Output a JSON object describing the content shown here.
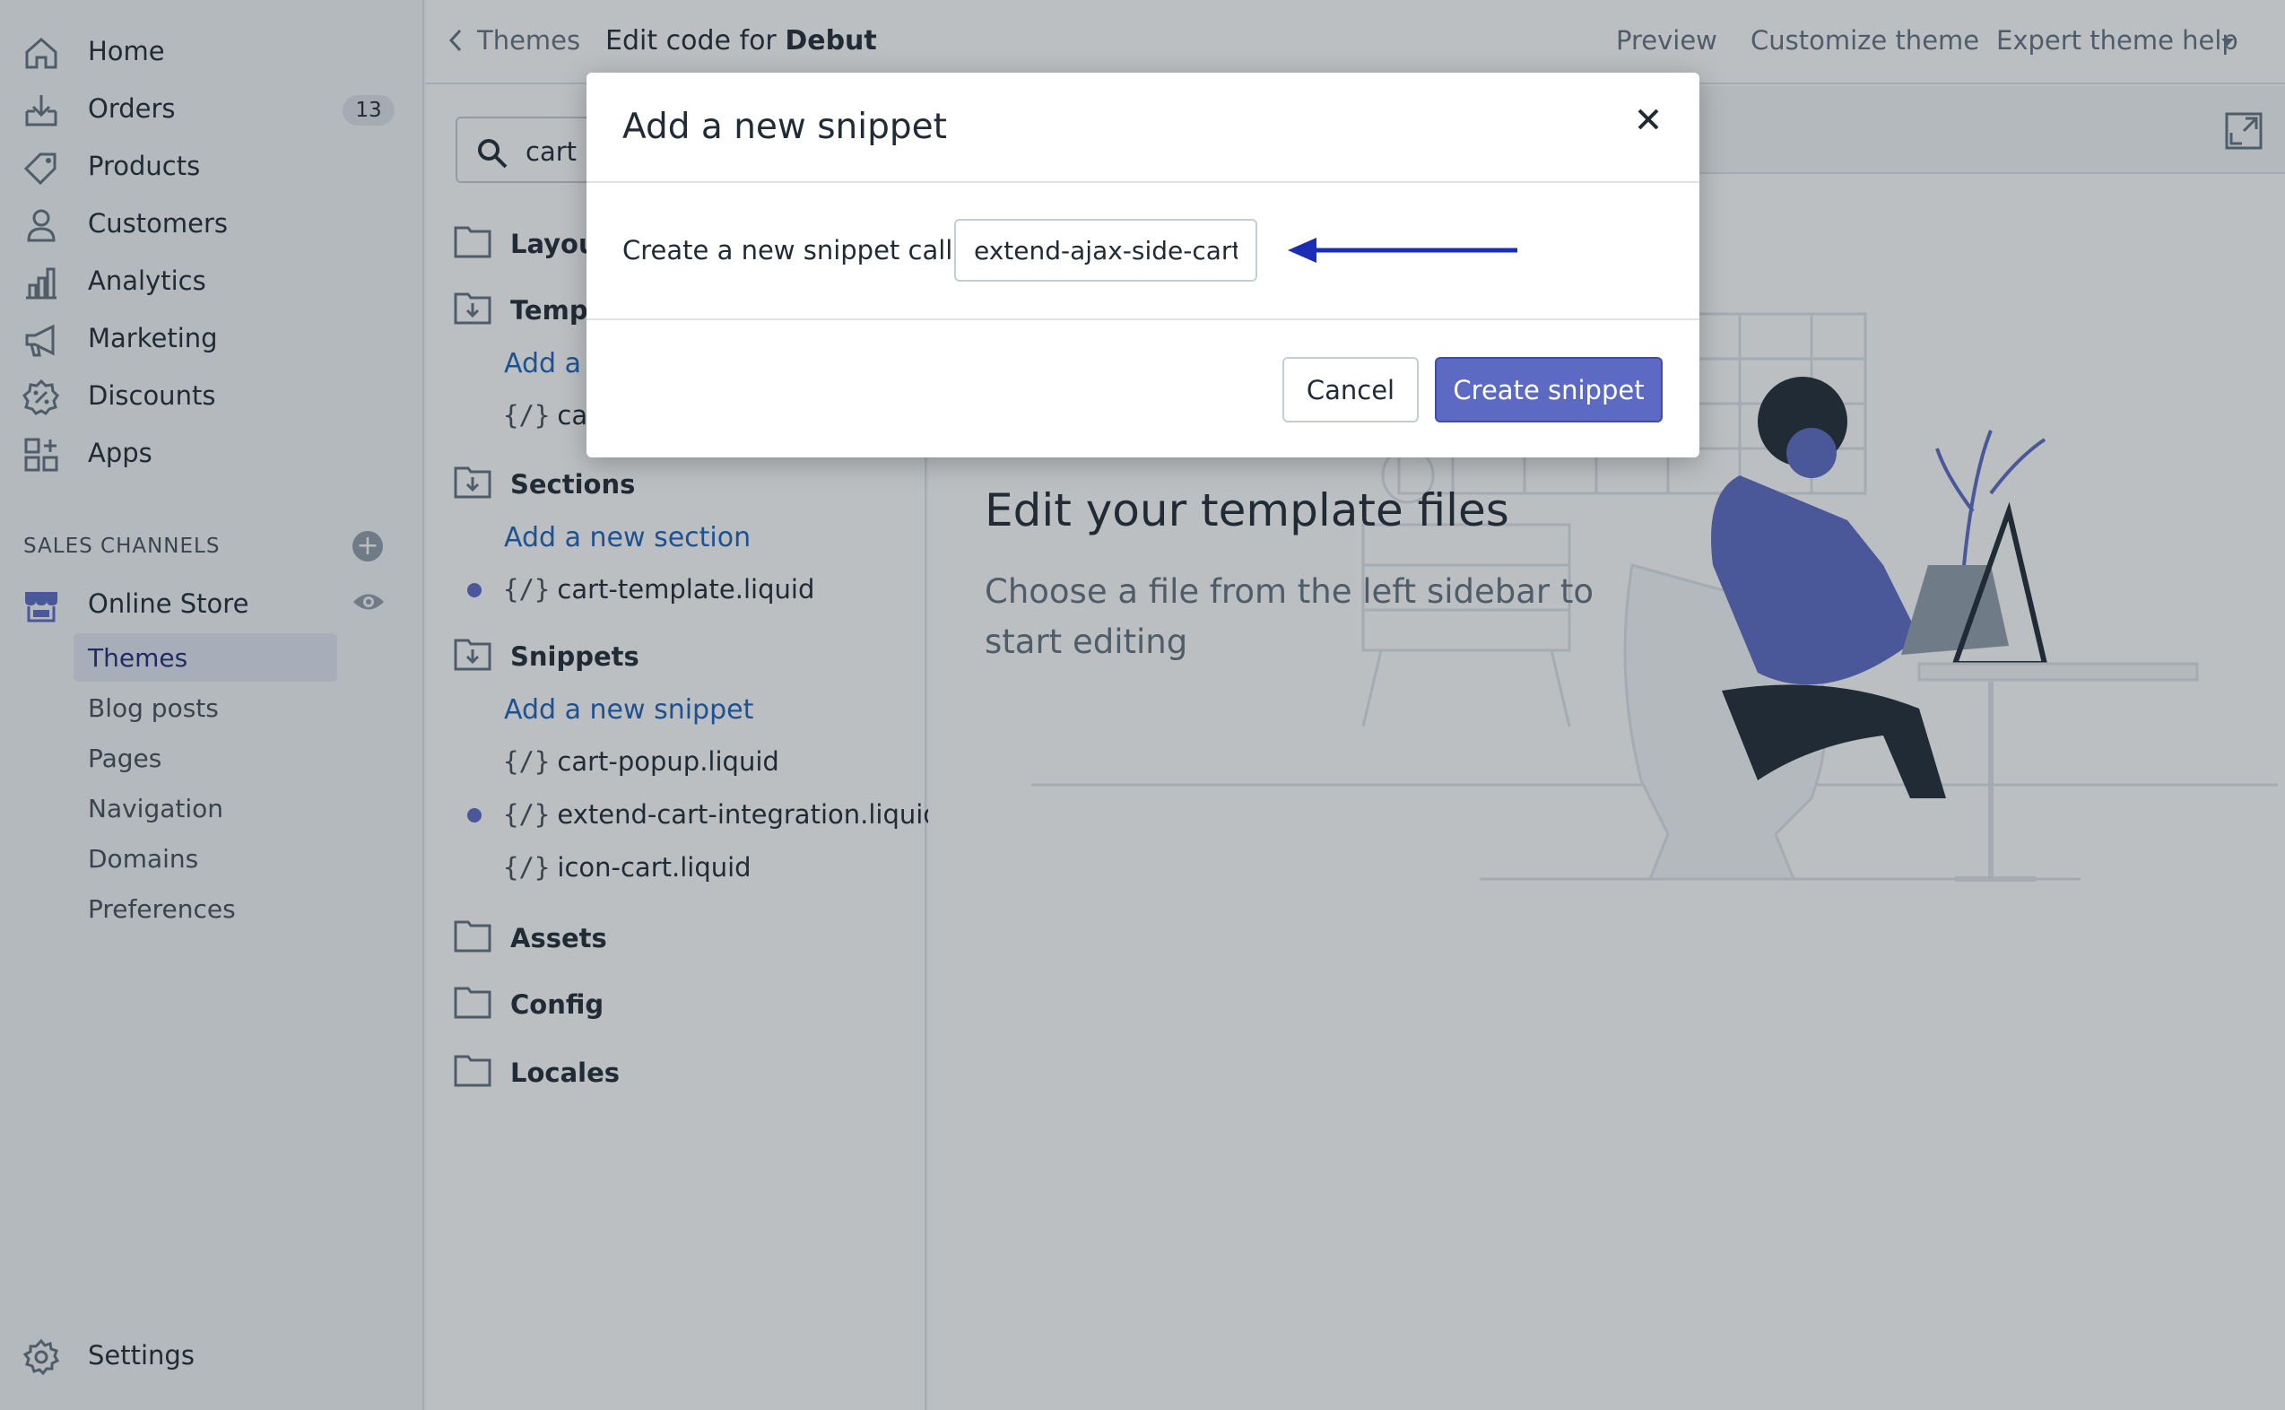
{
  "sidebar": {
    "items": [
      {
        "label": "Home",
        "icon": "home-icon"
      },
      {
        "label": "Orders",
        "icon": "orders-icon",
        "badge": "13"
      },
      {
        "label": "Products",
        "icon": "tag-icon"
      },
      {
        "label": "Customers",
        "icon": "person-icon"
      },
      {
        "label": "Analytics",
        "icon": "bar-chart-icon"
      },
      {
        "label": "Marketing",
        "icon": "megaphone-icon"
      },
      {
        "label": "Discounts",
        "icon": "discount-icon"
      },
      {
        "label": "Apps",
        "icon": "apps-icon"
      }
    ],
    "sales_channels_title": "SALES CHANNELS",
    "online_store": "Online Store",
    "online_store_sub": [
      "Themes",
      "Blog posts",
      "Pages",
      "Navigation",
      "Domains",
      "Preferences"
    ],
    "settings": "Settings"
  },
  "topbar": {
    "back": "Themes",
    "title_prefix": "Edit code for",
    "title_theme": "Debut",
    "preview": "Preview",
    "customize": "Customize theme",
    "help": "Expert theme help"
  },
  "files": {
    "search_value": "cart",
    "layout": "Layout",
    "templates": "Templates",
    "template_add": "Add a new template",
    "template_file": "cart.liquid",
    "sections": "Sections",
    "section_add": "Add a new section",
    "section_file": "cart-template.liquid",
    "snippets": "Snippets",
    "snippet_add": "Add a new snippet",
    "snippet_files": [
      "cart-popup.liquid",
      "extend-cart-integration.liquid",
      "icon-cart.liquid"
    ],
    "assets": "Assets",
    "config": "Config",
    "locales": "Locales",
    "file_prefix": "{/}"
  },
  "main": {
    "heading": "Edit your template files",
    "text": "Choose a file from the left sidebar to start editing"
  },
  "modal": {
    "title": "Add a new snippet",
    "label": "Create a new snippet called",
    "input_value": "extend-ajax-side-cart-",
    "cancel": "Cancel",
    "create": "Create snippet"
  },
  "colors": {
    "accent": "#5c6ac4",
    "link": "#1c62b9",
    "annotation_arrow": "#1a2db5"
  }
}
